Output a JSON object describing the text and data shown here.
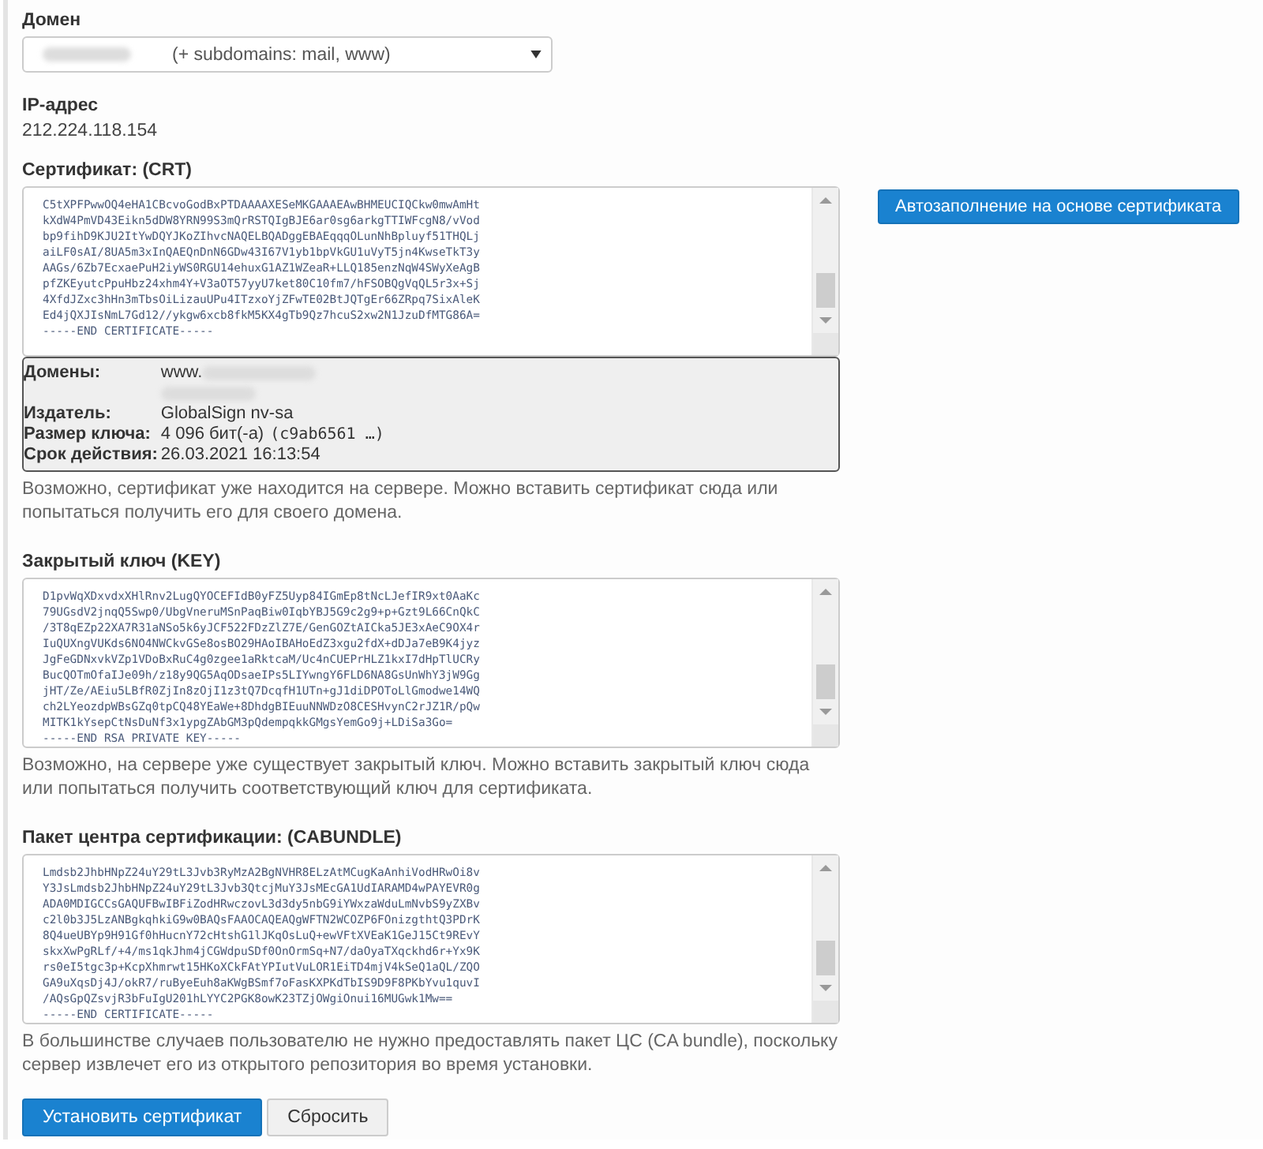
{
  "domain": {
    "label": "Домен",
    "value": "(+ subdomains: mail, www)"
  },
  "ip": {
    "label": "IP-адрес",
    "value": "212.224.118.154"
  },
  "autofill_button": "Автозаполнение на основе сертификата",
  "certificate": {
    "label": "Сертификат: (CRT)",
    "lines": [
      "C5tXPFPwwOQ4eHA1CBcvoGodBxPTDAAAAXESeMKGAAAEAwBHMEUCIQCkw0mwAmHt",
      "kXdW4PmVD43Eikn5dDW8YRN99S3mQrRSTQIgBJE6ar0sg6arkgTTIWFcgN8/vVod",
      "bp9fihD9KJU2ItYwDQYJKoZIhvcNAQELBQADggEBAEqqqOLunNhBpluyf51THQLj",
      "aiLF0sAI/8UA5m3xInQAEQnDnN6GDw43I67V1yb1bpVkGU1uVyT5jn4KwseTkT3y",
      "AAGs/6Zb7EcxaePuH2iyWS0RGU14ehuxG1AZ1WZeaR+LLQ185enzNqW4SWyXeAgB",
      "pfZKEyutcPpuHbz24xhm4Y+V3aOT57yyU7ket80C10fm7/hFSOBQgVqQL5r3x+Sj",
      "4XfdJZxc3hHn3mTbsOiLizauUPu4ITzxoYjZFwTE02BtJQTgEr66ZRpq7SixAleK",
      "Ed4jQXJIsNmL7Gd12//ykgw6xcb8fkM5KX4gTb9Qz7hcuS2xw2N1JzuDfMTG86A=",
      "-----END CERTIFICATE-----"
    ],
    "info": [
      {
        "label": "Домены:",
        "values": [
          "www."
        ],
        "blurred_second_line": true
      },
      {
        "label": "Издатель:",
        "values": [
          "GlobalSign nv-sa"
        ]
      },
      {
        "label": "Размер ключа:",
        "values": [
          "4 096 бит(-а)"
        ],
        "code": "(c9ab6561 …)"
      },
      {
        "label": "Срок действия:",
        "values": [
          "26.03.2021 16:13:54"
        ]
      }
    ],
    "help": "Возможно, сертификат уже находится на сервере. Можно вставить сертификат сюда или попытаться получить его для своего домена."
  },
  "private_key": {
    "label": "Закрытый ключ (KEY)",
    "lines": [
      "D1pvWqXDxvdxXHlRnv2LugQYOCEFIdB0yFZ5Uyp84IGmEp8tNcLJefIR9xt0AaKc",
      "79UGsdV2jnqQ5Swp0/UbgVneruMSnPaqBiw0IqbYBJ5G9c2g9+p+Gzt9L66CnQkC",
      "/3T8qEZp22XA7R31aNSo5k6yJCF522FDzZlZ7E/GenGOZtAICka5JE3xAeC9OX4r",
      "IuQUXngVUKds6NO4NWCkvGSe8osBO29HAoIBAHoEdZ3xgu2fdX+dDJa7eB9K4jyz",
      "JgFeGDNxvkVZp1VDoBxRuC4g0zgee1aRktcaM/Uc4nCUEPrHLZ1kxI7dHpTlUCRy",
      "BucQOTmOfaIJe09h/z18y9QG5AqODsaeIPs5LIYwngY6FLD6NA8GsUnWhY3jW9Gg",
      "jHT/Ze/AEiu5LBfR0ZjIn8zOjI1z3tQ7DcqfH1UTn+gJ1diDPOToLlGmodwe14WQ",
      "ch2LYeozdpWBsGZq0tpCQ48YEaWe+8DhdgBIEuuNNWDzO8CESHvynC2rJZ1R/pQw",
      "MITK1kYsepCtNsDuNf3x1ypgZAbGM3pQdempqkkGMgsYemGo9j+LDiSa3Go=",
      "-----END RSA PRIVATE KEY-----"
    ],
    "help": "Возможно, на сервере уже существует закрытый ключ. Можно вставить закрытый ключ сюда или попытаться получить соответствующий ключ для сертификата."
  },
  "ca_bundle": {
    "label": "Пакет центра сертификации: (CABUNDLE)",
    "lines": [
      "Lmdsb2JhbHNpZ24uY29tL3Jvb3RyMzA2BgNVHR8ELzAtMCugKaAnhiVodHRwOi8v",
      "Y3JsLmdsb2JhbHNpZ24uY29tL3Jvb3QtcjMuY3JsMEcGA1UdIARAMD4wPAYEVR0g",
      "ADA0MDIGCCsGAQUFBwIBFiZodHRwczovL3d3dy5nbG9iYWxzaWduLmNvbS9yZXBv",
      "c2l0b3J5LzANBgkqhkiG9w0BAQsFAAOCAQEAQgWFTN2WCOZP6FOnizgthtQ3PDrK",
      "8Q4ueUBYp9H91Gf0hHucnY72cHtshG1lJKqOsLuQ+ewVFtXVEaK1GeJ15Ct9REvY",
      "skxXwPgRLf/+4/ms1qkJhm4jCGWdpuSDf0OnOrmSq+N7/daOyaTXqckhd6r+Yx9K",
      "rs0eI5tgc3p+KcpXhmrwt15HKoXCkFAtYPIutVuLOR1EiTD4mjV4kSeQ1aQL/ZQO",
      "GA9uXqsDj4J/okR7/ruByeEuh8aKWgBSmf7oFasKXPKdTbIS9D9F8PKbYvu1quvI",
      "/AQsGpQZsvjR3bFuIgU201hLYYC2PGK8owK23TZjOWgiOnui16MUGwk1Mw==",
      "-----END CERTIFICATE-----"
    ],
    "help": "В большинстве случаев пользователю не нужно предоставлять пакет ЦС (CA bundle), поскольку сервер извлечет его из открытого репозитория во время установки."
  },
  "buttons": [
    {
      "kind": "primary",
      "label": "Установить сертификат"
    },
    {
      "kind": "secondary",
      "label": "Сбросить"
    }
  ]
}
